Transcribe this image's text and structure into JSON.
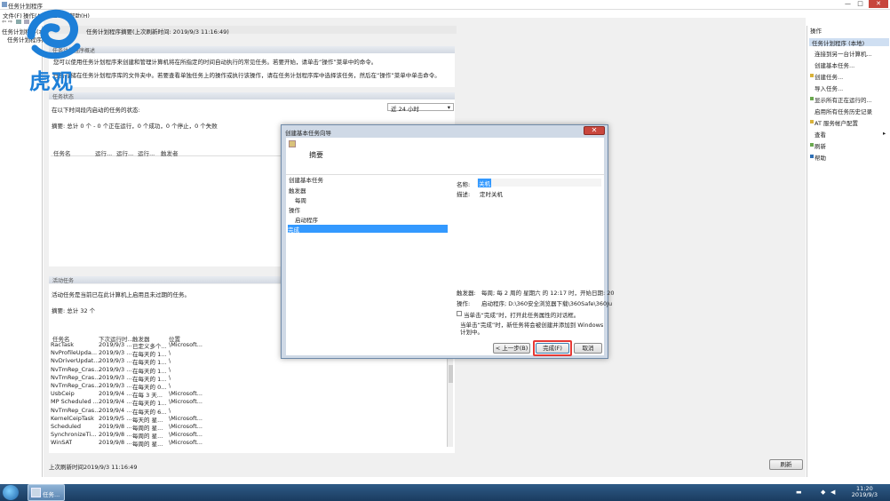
{
  "window": {
    "title": "任务计划程序",
    "controls": [
      "—",
      "□",
      "✕"
    ]
  },
  "menu": [
    "文件(F)",
    "操作(A)",
    "查看(V)",
    "帮助(H)"
  ],
  "logo": {
    "text": "虎观"
  },
  "tree": {
    "root": "任务计划程序(本地)",
    "child": "任务计划程序库"
  },
  "center": {
    "header": "任务计划程序摘要(上次刷新时间: 2019/9/3 11:16:49)",
    "overview_section": "任务计划程序概述",
    "overview_line1": "您可以使用任务计划程序来创建和管理计算机将在所指定的时间自动执行的常见任务。若要开始，请单击“操作”菜单中的命令。",
    "overview_line2": "任务存储在任务计划程序库的文件夹中。若要查看单独任务上的操作或执行该操作，请在任务计划程序库中选择该任务，然后在“操作”菜单中单击命令。",
    "status_section": "任务状态",
    "status_prompt": "在以下时间段内启动的任务的状态:",
    "status_range": "近 24 小时",
    "status_summary": "摘要: 总计 0 个 - 0 个正在运行，0 个成功，0 个停止，0 个失败",
    "status_columns": [
      "任务名",
      "运行...",
      "运行...",
      "运行...",
      "触发者"
    ],
    "active_section": "活动任务",
    "active_desc": "活动任务是当前已在此计算机上启用且未过期的任务。",
    "active_summary": "摘要: 总计 32 个",
    "active_columns": [
      "任务名",
      "下次运行时...",
      "触发器",
      "位置"
    ],
    "active_rows": [
      [
        "RacTask",
        "2019/9/3 ...",
        "已定义多个...",
        "\\Microsoft..."
      ],
      [
        "NvProfileUpda...",
        "2019/9/3 ...",
        "在每天的 1...",
        "\\"
      ],
      [
        "NvDriverUpdat...",
        "2019/9/3 ...",
        "在每天的 1...",
        "\\"
      ],
      [
        "NvTmRep_Cras...",
        "2019/9/3 ...",
        "在每天的 1...",
        "\\"
      ],
      [
        "NvTmRep_Cras...",
        "2019/9/3 ...",
        "在每天的 1...",
        "\\"
      ],
      [
        "NvTmRep_Cras...",
        "2019/9/3 ...",
        "在每天的 0...",
        "\\"
      ],
      [
        "UsbCeip",
        "2019/9/4 ...",
        "在每 3 天...",
        "\\Microsoft..."
      ],
      [
        "MP Scheduled ...",
        "2019/9/4 ...",
        "在每天的 1...",
        "\\Microsoft..."
      ],
      [
        "NvTmRep_Cras...",
        "2019/9/4 ...",
        "在每天的 6...",
        "\\"
      ],
      [
        "KernelCeipTask",
        "2019/9/5 ...",
        "每天的 星...",
        "\\Microsoft..."
      ],
      [
        "Scheduled",
        "2019/9/8 ...",
        "每周的 星...",
        "\\Microsoft..."
      ],
      [
        "SynchronizeTi...",
        "2019/9/8 ...",
        "每周的 星...",
        "\\Microsoft..."
      ],
      [
        "WinSAT",
        "2019/9/8 ...",
        "每周的 星...",
        "\\Microsoft..."
      ]
    ],
    "last_refresh": "上次刷新时间2019/9/3 11:16:49",
    "refresh_label": "刷新"
  },
  "actions": {
    "header": "操作",
    "subheader": "任务计划程序 (本地)",
    "items": [
      "连接到另一台计算机...",
      "创建基本任务...",
      "创建任务...",
      "导入任务...",
      "显示所有正在运行的...",
      "启用所有任务历史记录",
      "AT 服务帐户配置",
      "查看",
      "刷新",
      "帮助"
    ]
  },
  "dialog": {
    "title": "创建基本任务向导",
    "heading": "摘要",
    "steps": [
      "创建基本任务",
      "触发器",
      "每周",
      "操作",
      "启动程序",
      "完成"
    ],
    "name_label": "名称:",
    "name_value": "关机",
    "desc_label": "描述:",
    "desc_value": "定时关机",
    "trigger_label": "触发器:",
    "trigger_value": "每周; 每 2 周的 星期六 的 12:17 时，开始日期: 20",
    "action_label": "操作:",
    "action_value": "启动程序; D:\\360安全浏览器下载\\360Safe\\360Ju",
    "checkbox_label": "当单击“完成”时，打开此任务属性的对话框。",
    "note_line1": "当单击“完成”时，新任务将会被创建并添加到 Windows",
    "note_line2": "计划中。",
    "back_label": "< 上一步(B)",
    "finish_label": "完成(F)",
    "cancel_label": "取消",
    "close_icon": "✕"
  },
  "taskbar": {
    "task_label": "任务...",
    "time": "11:20",
    "date": "2019/9/3"
  },
  "colors": {
    "accent": "#3399ff",
    "highlight": "#e53935"
  }
}
